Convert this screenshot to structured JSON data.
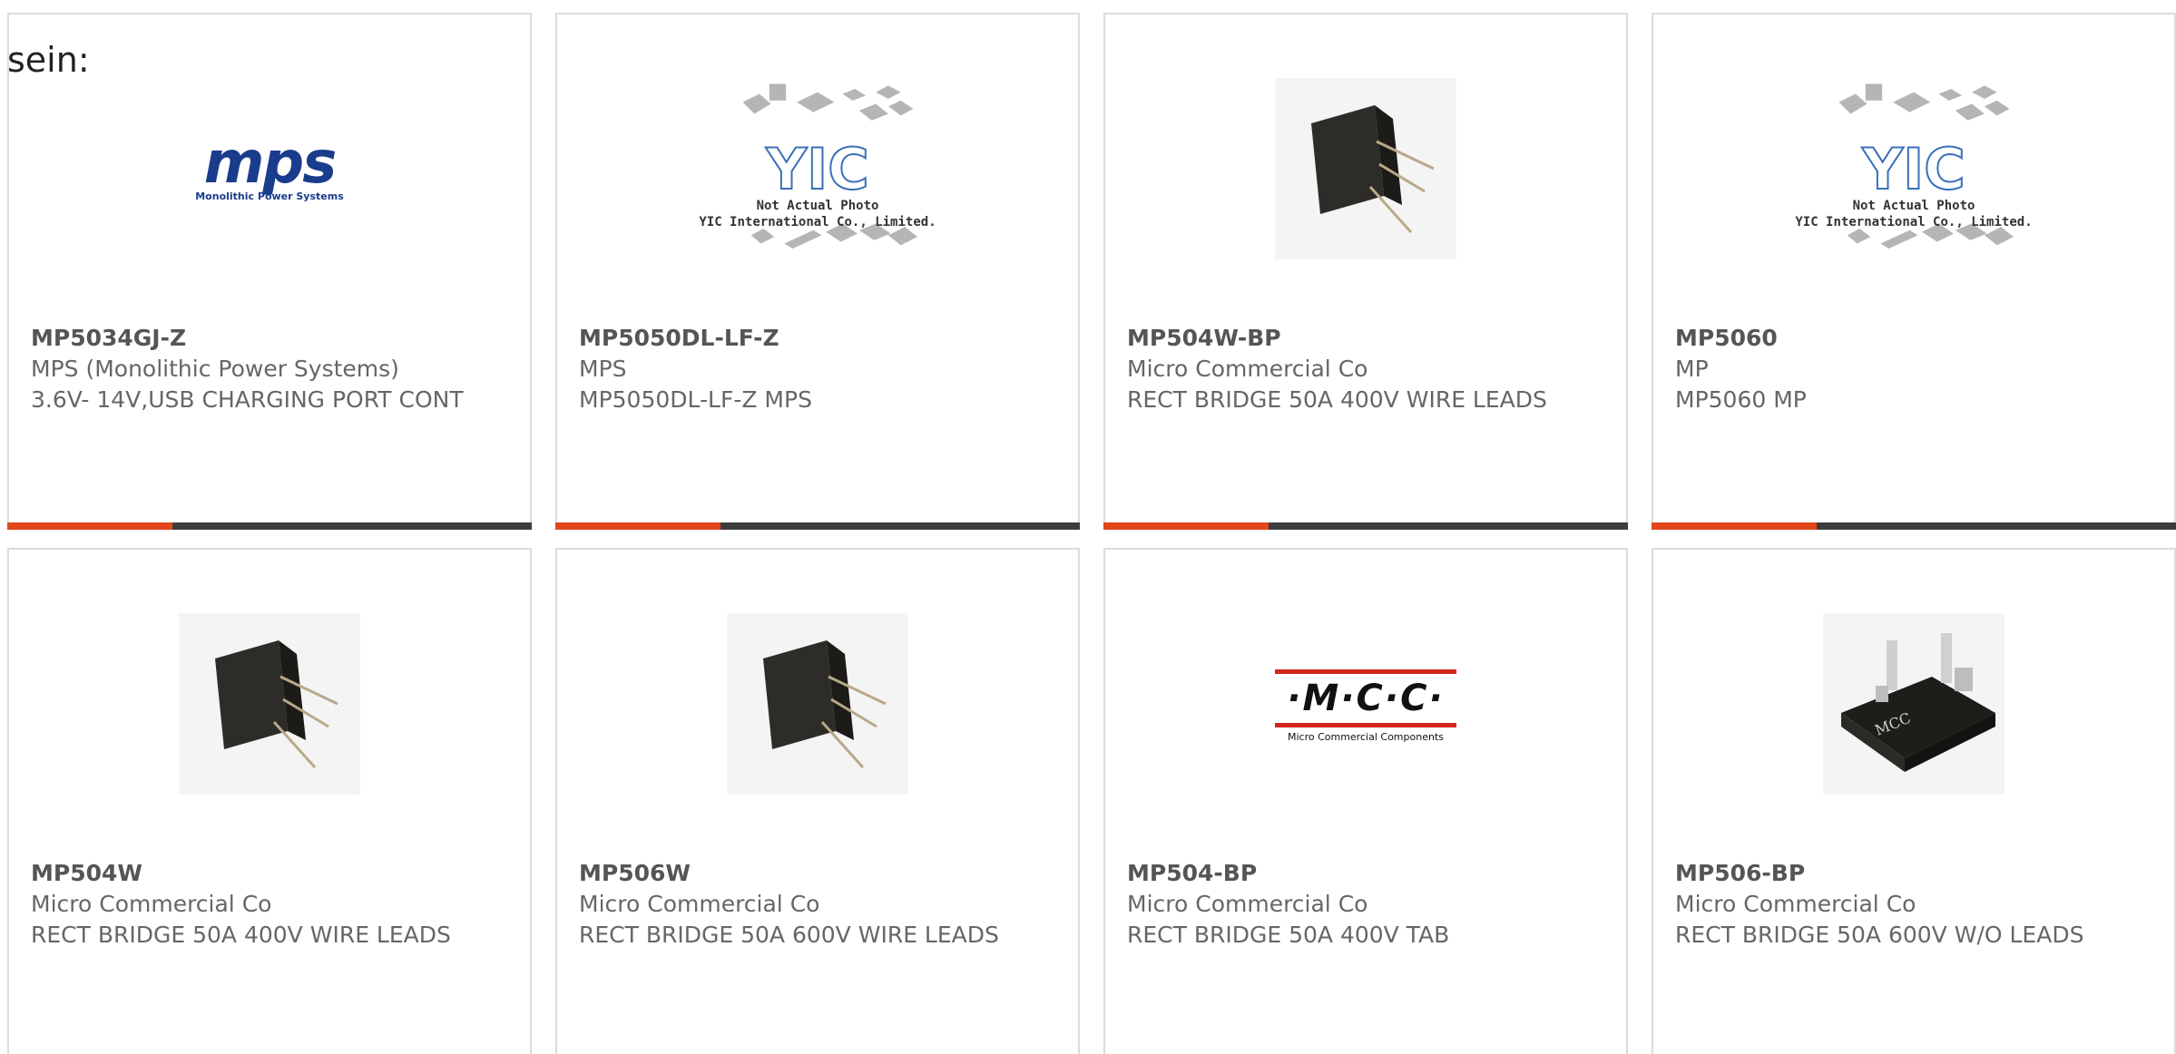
{
  "lead_text": "sein:",
  "products": [
    {
      "part_number": "MP5034GJ-Z",
      "manufacturer": "MPS (Monolithic Power Systems)",
      "description": "3.6V- 14V,USB CHARGING PORT CONT",
      "image": "mps-logo"
    },
    {
      "part_number": "MP5050DL-LF-Z",
      "manufacturer": "MPS",
      "description": "MP5050DL-LF-Z MPS",
      "image": "yic-placeholder"
    },
    {
      "part_number": "MP504W-BP",
      "manufacturer": "Micro Commercial Co",
      "description": "RECT BRIDGE 50A 400V WIRE LEADS",
      "image": "bridge-rectifier-wire"
    },
    {
      "part_number": "MP5060",
      "manufacturer": "MP",
      "description": "MP5060 MP",
      "image": "yic-placeholder"
    },
    {
      "part_number": "MP504W",
      "manufacturer": "Micro Commercial Co",
      "description": "RECT BRIDGE 50A 400V WIRE LEADS",
      "image": "bridge-rectifier-wire"
    },
    {
      "part_number": "MP506W",
      "manufacturer": "Micro Commercial Co",
      "description": "RECT BRIDGE 50A 600V WIRE LEADS",
      "image": "bridge-rectifier-wire"
    },
    {
      "part_number": "MP504-BP",
      "manufacturer": "Micro Commercial Co",
      "description": "RECT BRIDGE 50A 400V TAB",
      "image": "mcc-logo"
    },
    {
      "part_number": "MP506-BP",
      "manufacturer": "Micro Commercial Co",
      "description": "RECT BRIDGE 50A 600V W/O LEADS",
      "image": "bridge-rectifier-tab"
    }
  ],
  "logos": {
    "mps_word": "mps",
    "mps_sub": "Monolithic Power Systems",
    "yic_word": "YIC",
    "yic_note_1": "Not Actual Photo",
    "yic_note_2": "YIC International Co., Limited.",
    "mcc_word": "·M·C·C·",
    "mcc_sub": "Micro Commercial Components",
    "mcc_body_mark": "MCC"
  },
  "colors": {
    "accent": "#e2461a",
    "bar": "#3d3d3d",
    "border": "#dcdcdc",
    "text": "#666666"
  }
}
